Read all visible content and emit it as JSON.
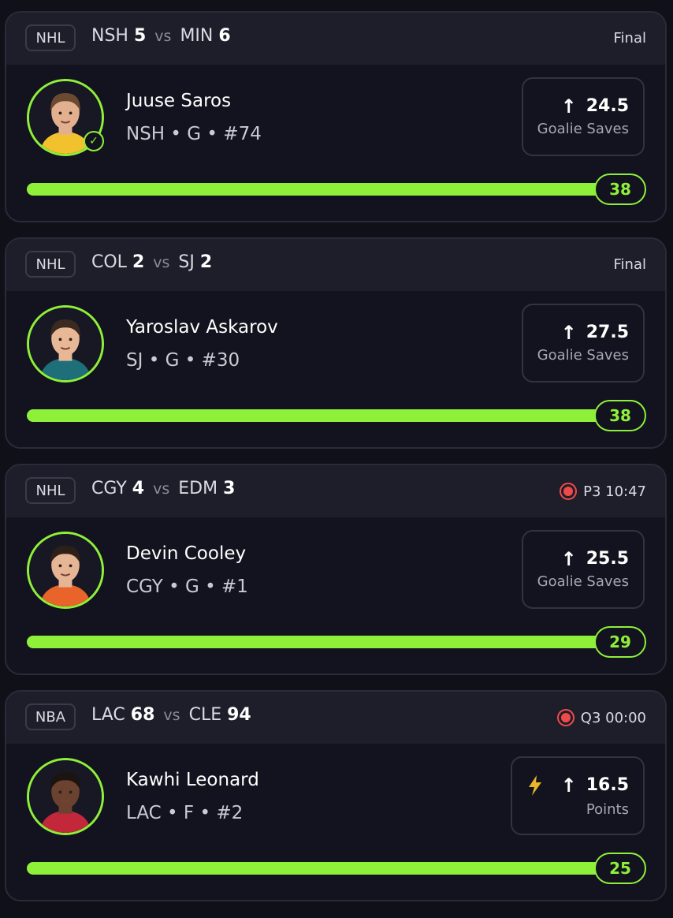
{
  "accent_color": "#8ff03a",
  "live_color": "#ef4a4a",
  "cards": [
    {
      "league": "NHL",
      "home": "NSH",
      "home_score": "5",
      "vs": "vs",
      "away": "MIN",
      "away_score": "6",
      "status": "Final",
      "live": false,
      "player": "Juuse Saros",
      "info": "NSH • G • #74",
      "verified": true,
      "direction_icon": "arrow-up-icon",
      "line": "24.5",
      "stat": "Goalie Saves",
      "boost": false,
      "current": "38",
      "progress": 1.0
    },
    {
      "league": "NHL",
      "home": "COL",
      "home_score": "2",
      "vs": "vs",
      "away": "SJ",
      "away_score": "2",
      "status": "Final",
      "live": false,
      "player": "Yaroslav Askarov",
      "info": "SJ • G • #30",
      "verified": false,
      "direction_icon": "arrow-up-icon",
      "line": "27.5",
      "stat": "Goalie Saves",
      "boost": false,
      "current": "38",
      "progress": 1.0
    },
    {
      "league": "NHL",
      "home": "CGY",
      "home_score": "4",
      "vs": "vs",
      "away": "EDM",
      "away_score": "3",
      "status": "P3 10:47",
      "live": true,
      "player": "Devin Cooley",
      "info": "CGY • G • #1",
      "verified": false,
      "direction_icon": "arrow-up-icon",
      "line": "25.5",
      "stat": "Goalie Saves",
      "boost": false,
      "current": "29",
      "progress": 1.0
    },
    {
      "league": "NBA",
      "home": "LAC",
      "home_score": "68",
      "vs": "vs",
      "away": "CLE",
      "away_score": "94",
      "status": "Q3 00:00",
      "live": true,
      "player": "Kawhi Leonard",
      "info": "LAC • F • #2",
      "verified": false,
      "direction_icon": "arrow-up-icon",
      "line": "16.5",
      "stat": "Points",
      "boost": true,
      "current": "25",
      "progress": 1.0
    }
  ]
}
